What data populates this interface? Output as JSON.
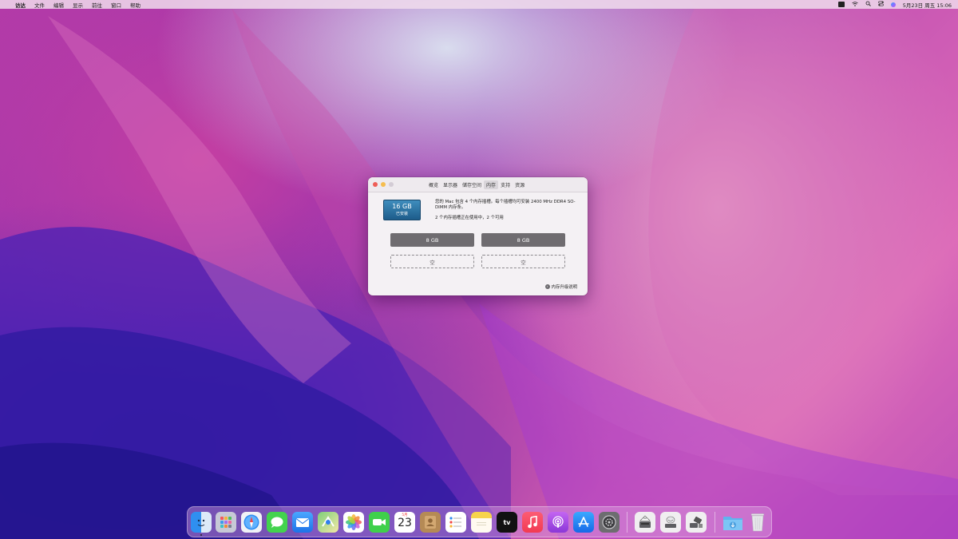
{
  "menubar": {
    "app_name": "访达",
    "items": [
      "文件",
      "编辑",
      "显示",
      "前往",
      "窗口",
      "帮助"
    ],
    "clock": "5月23日 周五 15:06"
  },
  "window": {
    "tabs": [
      "概览",
      "显示器",
      "储存空间",
      "内存",
      "支持",
      "资源"
    ],
    "active_tab": "内存",
    "memory_badge": {
      "size": "16 GB",
      "label": "已安装"
    },
    "description": "您的 Mac 包含 4 个内存插槽。每个插槽均可安装 2400 MHz DDR4 SO-DIMM 内存条。",
    "slots_summary": "2 个内存插槽正在使用中，2 个可用",
    "slots": [
      {
        "label": "8 GB",
        "state": "filled"
      },
      {
        "label": "8 GB",
        "state": "filled"
      },
      {
        "label": "空",
        "state": "empty"
      },
      {
        "label": "空",
        "state": "empty"
      }
    ],
    "help_link": "内存升级说明"
  },
  "dock": {
    "calendar_month": "5月",
    "calendar_day": "23",
    "appletv_label": "tv",
    "icons": [
      "finder-icon",
      "launchpad-icon",
      "safari-icon",
      "messages-icon",
      "mail-icon",
      "maps-icon",
      "photos-icon",
      "facetime-icon",
      "calendar-icon",
      "contacts-icon",
      "reminders-icon",
      "notes-icon",
      "appletv-icon",
      "music-icon",
      "podcasts-icon",
      "appstore-icon",
      "system-preferences-icon",
      "disk-utility-icon",
      "migration-icon",
      "boot-camp-icon",
      "downloads-icon",
      "trash-icon"
    ]
  },
  "colors": {
    "traffic_red": "#ee5e57",
    "traffic_yellow": "#f5bd4f",
    "traffic_green_inactive": "#d3ccd5",
    "badge_blue": "#2a6f9f"
  }
}
